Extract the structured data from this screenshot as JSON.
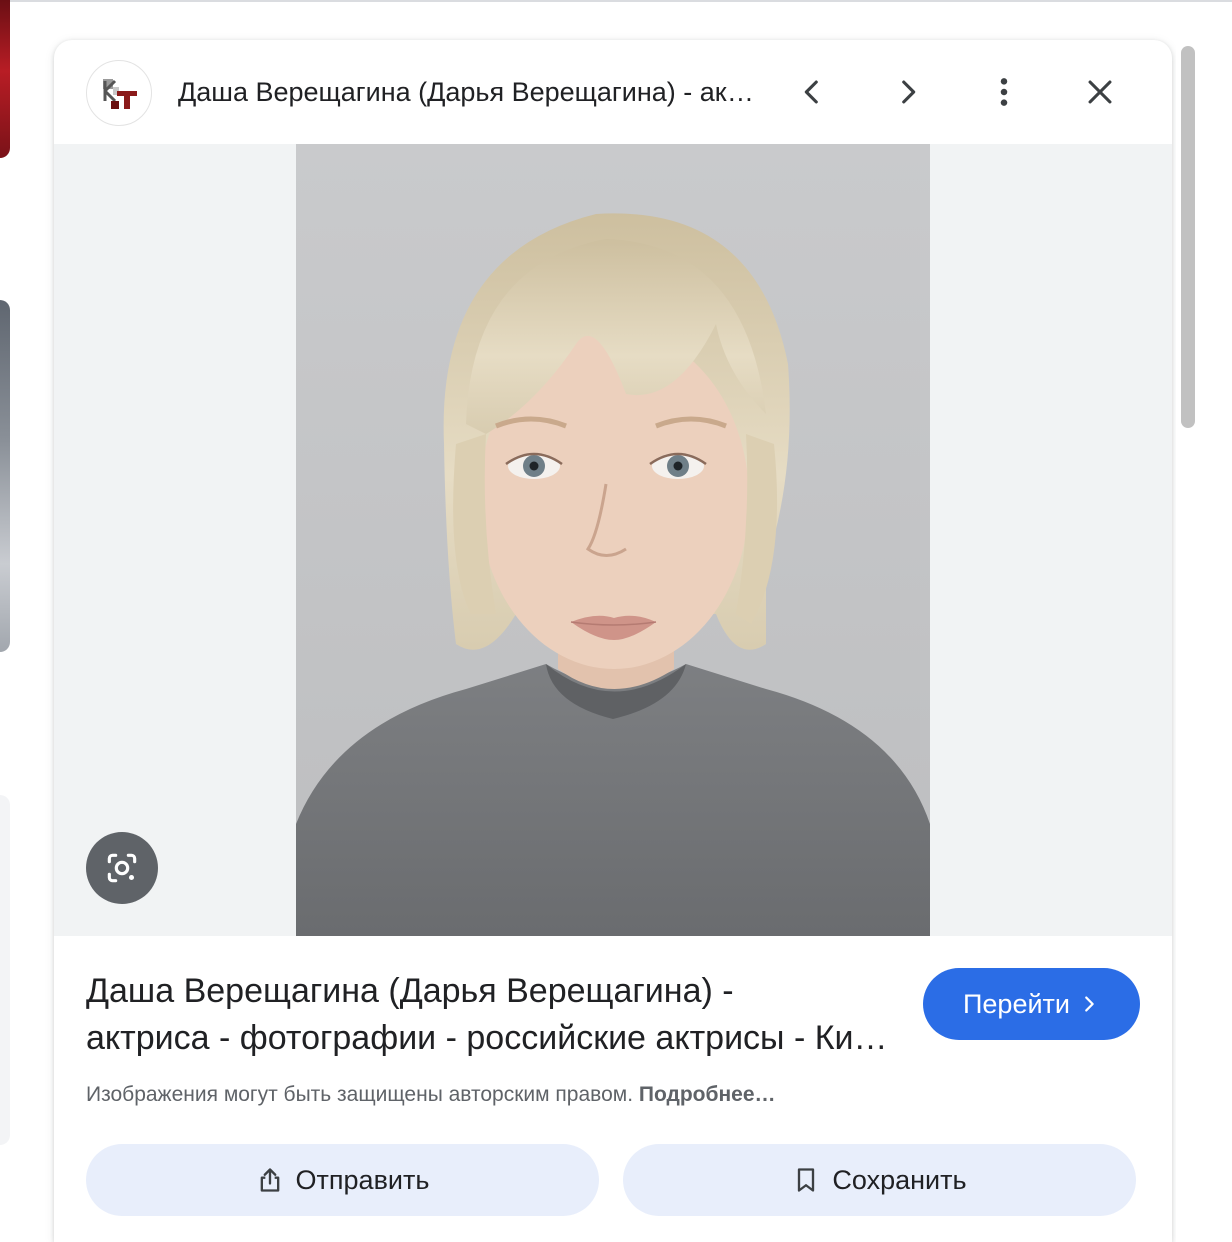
{
  "header": {
    "title": "Даша Верещагина (Дарья Верещагина) - актриса - фотографии - российские актрисы - Кино-Театр.Ру",
    "favicon_icon": "kt-site-logo",
    "prev_icon": "chevron-left-icon",
    "next_icon": "chevron-right-icon",
    "more_icon": "more-vert-icon",
    "close_icon": "close-icon"
  },
  "image": {
    "lens_icon": "google-lens-icon"
  },
  "result": {
    "title_line1": "Даша Верещагина (Дарья Верещагина) -",
    "title_line2": "актриса - фотографии - российские актрисы - Кино-Театр.Ру",
    "visit_label": "Перейти",
    "copyright_text": "Изображения могут быть защищены авторским правом.",
    "learn_more": "Подробнее…"
  },
  "actions": {
    "share_label": "Отправить",
    "save_label": "Сохранить"
  },
  "colors": {
    "accent": "#2b6de6",
    "action_bg": "#e8eefb",
    "image_bg": "#f1f3f4"
  }
}
